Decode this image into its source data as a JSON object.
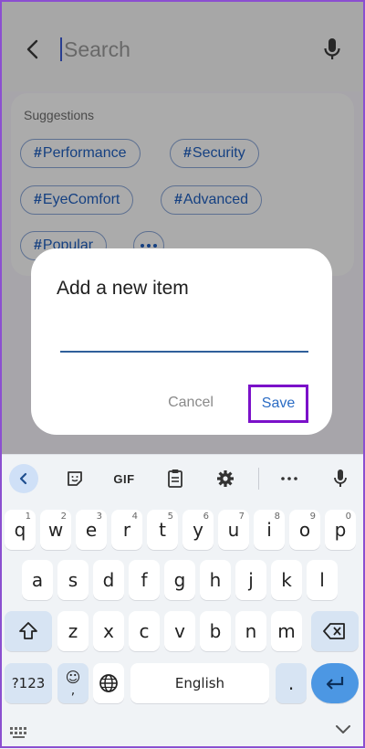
{
  "search": {
    "placeholder": "Search"
  },
  "suggestions": {
    "title": "Suggestions",
    "chips": [
      {
        "hash": "#",
        "label": "Performance"
      },
      {
        "hash": "#",
        "label": "Security"
      },
      {
        "hash": "#",
        "label": "EyeComfort"
      },
      {
        "hash": "#",
        "label": "Advanced"
      },
      {
        "hash": "#",
        "label": "Popular"
      }
    ]
  },
  "dialog": {
    "title": "Add a new item",
    "input_value": "",
    "cancel_label": "Cancel",
    "save_label": "Save"
  },
  "keyboard": {
    "toolbar": {
      "gif_label": "GIF"
    },
    "row1": [
      {
        "key": "q",
        "hint": "1"
      },
      {
        "key": "w",
        "hint": "2"
      },
      {
        "key": "e",
        "hint": "3"
      },
      {
        "key": "r",
        "hint": "4"
      },
      {
        "key": "t",
        "hint": "5"
      },
      {
        "key": "y",
        "hint": "6"
      },
      {
        "key": "u",
        "hint": "7"
      },
      {
        "key": "i",
        "hint": "8"
      },
      {
        "key": "o",
        "hint": "9"
      },
      {
        "key": "p",
        "hint": "0"
      }
    ],
    "row2": [
      "a",
      "s",
      "d",
      "f",
      "g",
      "h",
      "j",
      "k",
      "l"
    ],
    "row3": [
      "z",
      "x",
      "c",
      "v",
      "b",
      "n",
      "m"
    ],
    "symbols_label": "?123",
    "emoji_label": "☺",
    "emoji_sub": ",",
    "space_label": "English",
    "period_label": "."
  },
  "colors": {
    "accent": "#1f5fbf",
    "save_highlight": "#7b11c9",
    "enter_key": "#4c97e3"
  },
  "icons": {
    "back": "arrow-left-icon",
    "mic": "microphone-icon",
    "more": "more-horizontal-icon",
    "collapse": "chevron-left-icon",
    "sticker": "sticker-icon",
    "clipboard": "clipboard-icon",
    "settings": "gear-icon",
    "shift": "shift-icon",
    "backspace": "backspace-icon",
    "globe": "globe-icon",
    "enter": "enter-icon",
    "keyboard_grid": "keyboard-grid-icon",
    "hide_keyboard": "chevron-down-icon"
  }
}
